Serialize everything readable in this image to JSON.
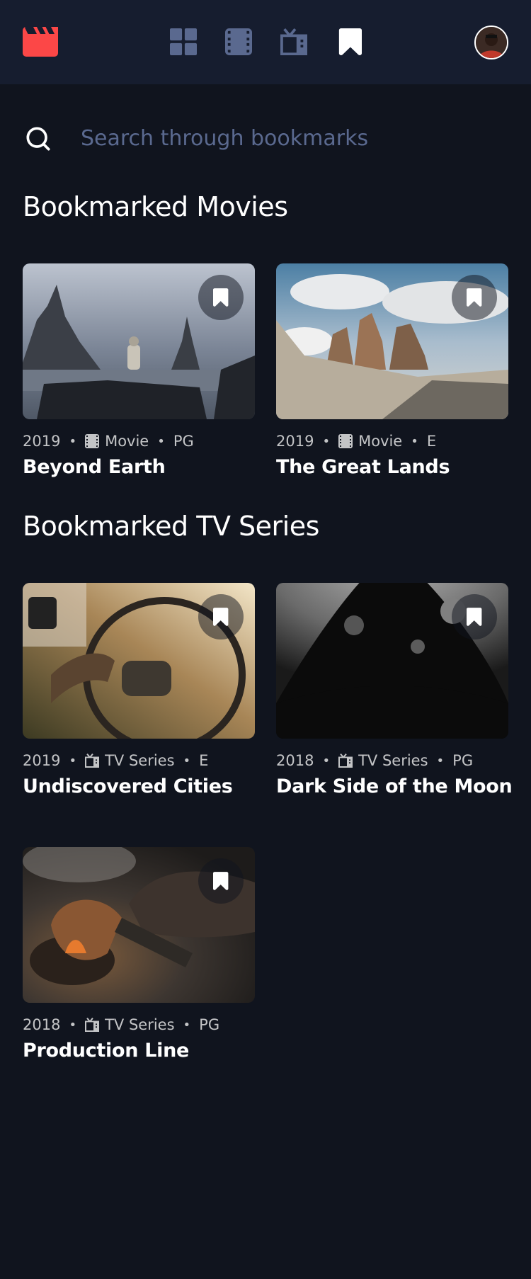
{
  "nav": {
    "logo": "movie-logo-icon",
    "items": [
      {
        "name": "home",
        "icon": "grid-icon",
        "active": false
      },
      {
        "name": "movies",
        "icon": "film-icon",
        "active": false
      },
      {
        "name": "tv-series",
        "icon": "tv-icon",
        "active": false
      },
      {
        "name": "bookmarks",
        "icon": "bookmark-icon",
        "active": true
      }
    ],
    "avatar": "user-avatar"
  },
  "search": {
    "placeholder": "Search through bookmarks",
    "value": ""
  },
  "sections": {
    "movies": {
      "title": "Bookmarked Movies",
      "items": [
        {
          "year": "2019",
          "category": "Movie",
          "rating": "PG",
          "title": "Beyond Earth",
          "bookmarked": true
        },
        {
          "year": "2019",
          "category": "Movie",
          "rating": "E",
          "title": "The Great Lands",
          "bookmarked": true
        }
      ]
    },
    "tv": {
      "title": "Bookmarked TV Series",
      "items": [
        {
          "year": "2019",
          "category": "TV Series",
          "rating": "E",
          "title": "Undiscovered Cities",
          "bookmarked": true
        },
        {
          "year": "2018",
          "category": "TV Series",
          "rating": "PG",
          "title": "Dark Side of the Moon",
          "bookmarked": true
        },
        {
          "year": "2018",
          "category": "TV Series",
          "rating": "PG",
          "title": "Production Line",
          "bookmarked": true
        }
      ]
    }
  },
  "colors": {
    "background": "#10141E",
    "nav_background": "#161D2F",
    "accent_red": "#FC4747",
    "nav_icon": "#5A698F",
    "text": "#FFFFFF"
  }
}
